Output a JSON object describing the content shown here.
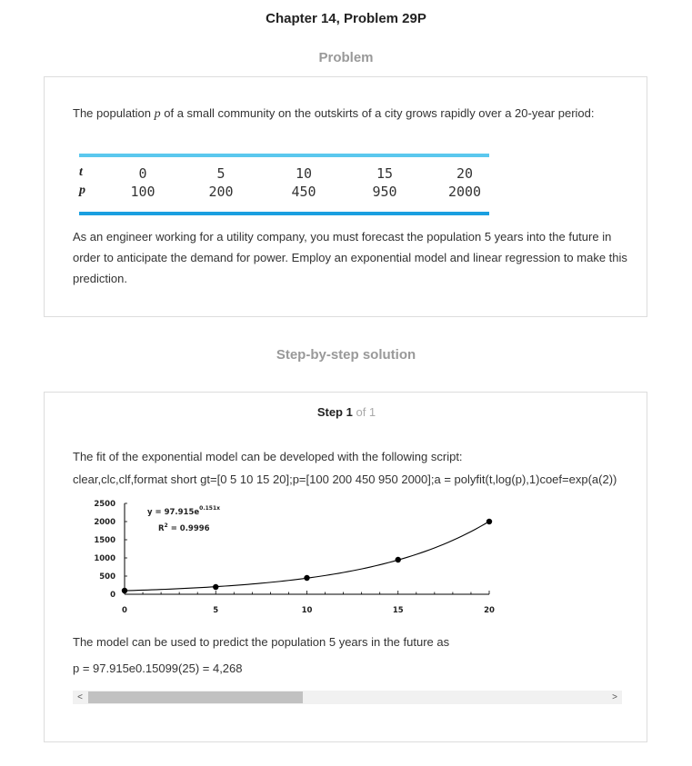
{
  "page": {
    "chapter_title": "Chapter 14, Problem 29P",
    "problem_heading": "Problem",
    "solution_heading": "Step-by-step solution"
  },
  "problem": {
    "intro_before": "The population ",
    "intro_var": "p",
    "intro_after": " of a small community on the outskirts of a city grows rapidly over a 20-year period:",
    "table": {
      "row_t_label": "t",
      "row_p_label": "p",
      "t_values": [
        "0",
        "5",
        "10",
        "15",
        "20"
      ],
      "p_values": [
        "100",
        "200",
        "450",
        "950",
        "2000"
      ]
    },
    "body": "As an engineer working for a utility company, you must forecast the population 5 years into the future in order to anticipate the demand for power. Employ an exponential model and linear regression to make this prediction."
  },
  "solution": {
    "step_label": "Step 1",
    "step_of": "of 1",
    "intro": "The fit of the exponential model can be developed with the following script:",
    "code": "clear,clc,clf,format short gt=[0 5 10 15 20];p=[100 200 450 950 2000];a = polyfit(t,log(p),1)coef=exp(a(2))",
    "prediction_text": "The model can be used to predict the population 5 years in the future as",
    "prediction_formula": "p = 97.915e0.15099(25) = 4,268",
    "scroll_left": "<",
    "scroll_right": ">"
  },
  "chart_data": {
    "type": "scatter",
    "series": [
      {
        "x": [
          0,
          5,
          10,
          15,
          20
        ],
        "y": [
          100,
          200,
          450,
          950,
          2000
        ]
      }
    ],
    "fit": {
      "model": "exponential",
      "a": 97.915,
      "b": 0.151
    },
    "xlim": [
      0,
      20
    ],
    "ylim": [
      0,
      2500
    ],
    "x_ticks": [
      "0",
      "5",
      "10",
      "15",
      "20"
    ],
    "y_ticks": [
      "0",
      "500",
      "1000",
      "1500",
      "2000",
      "2500"
    ],
    "annotations": {
      "equation_prefix": "y = 97.915e",
      "equation_exponent": "0.151x",
      "r2_prefix": "R",
      "r2_sup": "2",
      "r2_suffix": " = 0.9996"
    },
    "grid": false
  }
}
